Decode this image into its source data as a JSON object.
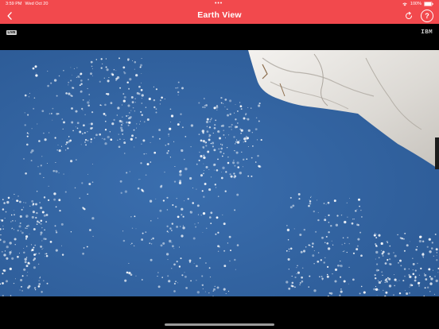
{
  "status_bar": {
    "time": "3:59 PM",
    "date": "Wed Oct 20",
    "multitask_dots": "• • •",
    "battery": "100%",
    "icons": [
      "wifi-icon",
      "battery-icon"
    ]
  },
  "header": {
    "title": "Earth View",
    "back_icon": "chevron-left-icon",
    "refresh_icon": "refresh-icon",
    "help_label": "?",
    "background": "#f2494d"
  },
  "video": {
    "live_badge": "LIVE",
    "brand": "IBM",
    "ocean_color": "#32629f"
  }
}
